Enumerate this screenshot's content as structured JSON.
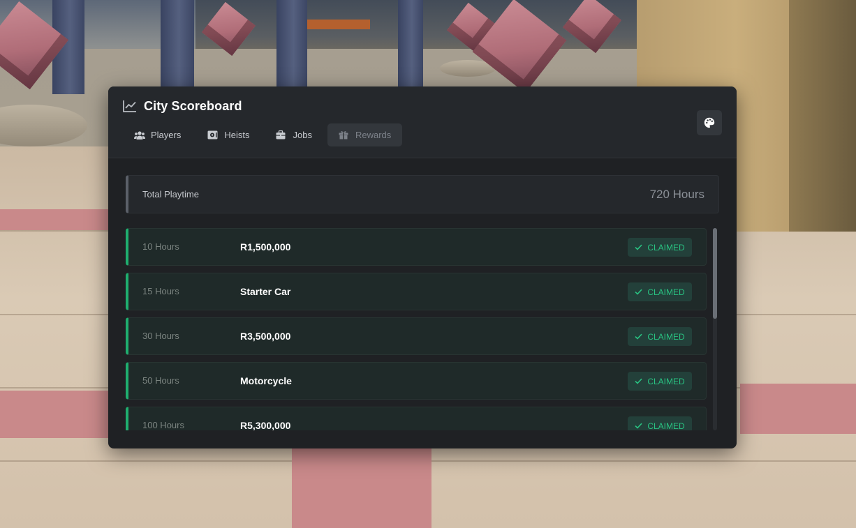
{
  "app": {
    "title": "City Scoreboard",
    "title_icon": "chart-line-icon",
    "theme_button_icon": "palette-icon"
  },
  "tabs": [
    {
      "label": "Players",
      "icon": "users-icon",
      "active": false
    },
    {
      "label": "Heists",
      "icon": "vault-icon",
      "active": false
    },
    {
      "label": "Jobs",
      "icon": "briefcase-icon",
      "active": false
    },
    {
      "label": "Rewards",
      "icon": "gift-icon",
      "active": true
    }
  ],
  "playtime": {
    "label": "Total Playtime",
    "value": "720 Hours"
  },
  "rewards": [
    {
      "hours": "10 Hours",
      "reward": "R1,500,000",
      "status": "CLAIMED"
    },
    {
      "hours": "15 Hours",
      "reward": "Starter Car",
      "status": "CLAIMED"
    },
    {
      "hours": "30 Hours",
      "reward": "R3,500,000",
      "status": "CLAIMED"
    },
    {
      "hours": "50 Hours",
      "reward": "Motorcycle",
      "status": "CLAIMED"
    },
    {
      "hours": "100 Hours",
      "reward": "R5,300,000",
      "status": "CLAIMED"
    }
  ],
  "colors": {
    "accent_green": "#1fae6f",
    "claimed_text": "#29c382",
    "panel_bg": "#1f2124"
  }
}
